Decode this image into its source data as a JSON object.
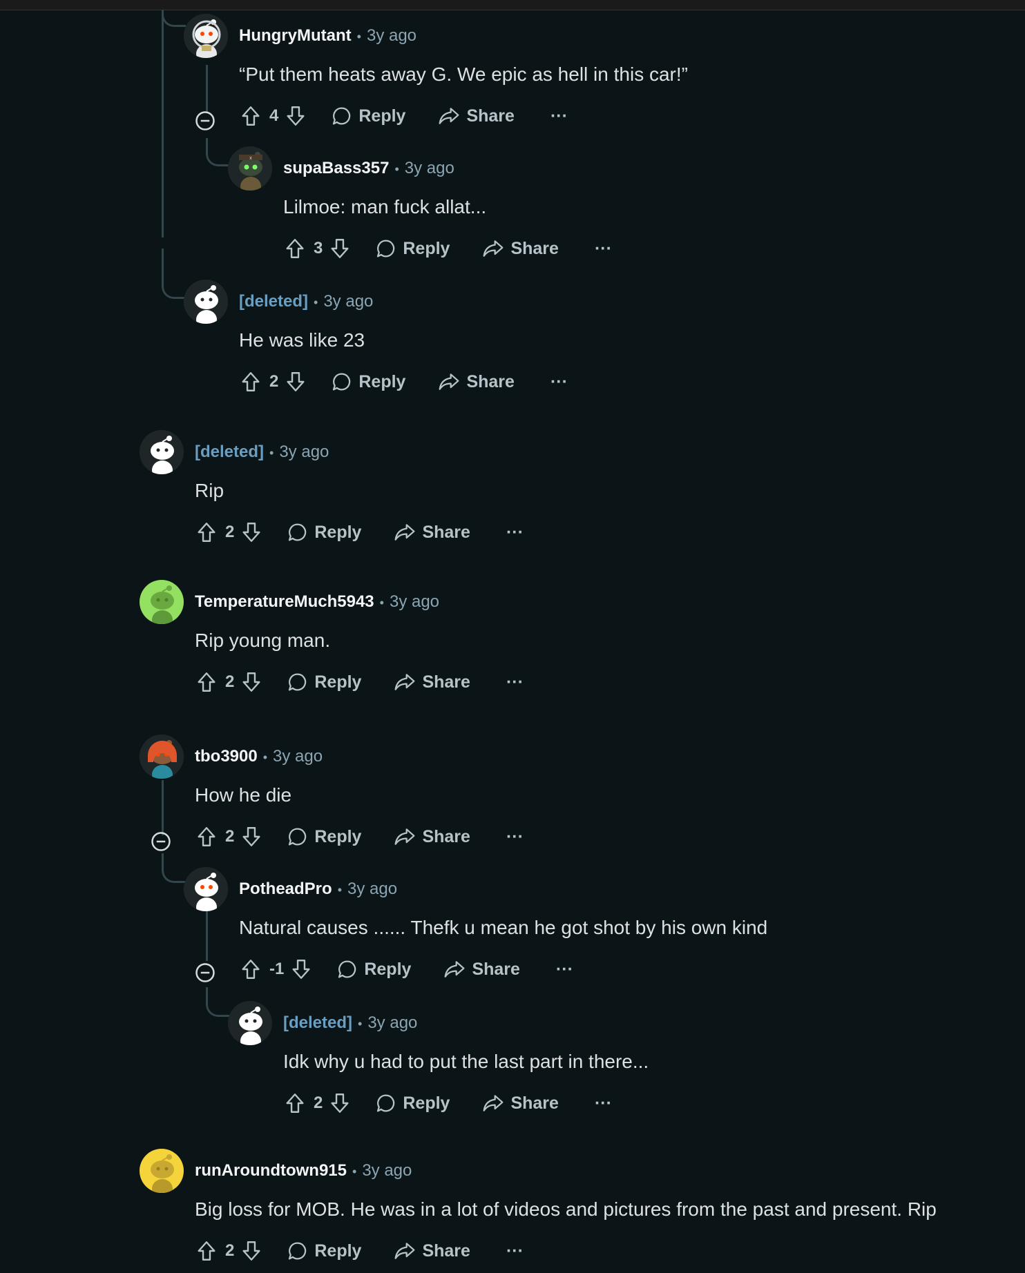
{
  "labels": {
    "reply": "Reply",
    "share": "Share",
    "more": "···"
  },
  "colors": {
    "background": "#0b1416",
    "deleted_author": "#6a9fc4",
    "meta_text": "#8aa5b3",
    "action_text": "#b6c3c9"
  },
  "comments": [
    {
      "author": "HungryMutant",
      "time": "3y ago",
      "body": "“Put them heats away G. We epic as hell in this car!”",
      "score": "4",
      "avatar_icon": "astronaut-snoo-avatar-icon"
    },
    {
      "author": "supaBass357",
      "time": "3y ago",
      "body": "Lilmoe: man fuck allat...",
      "score": "3",
      "avatar_icon": "pirate-snoo-avatar-icon"
    },
    {
      "author": "[deleted]",
      "time": "3y ago",
      "body": "He was like 23",
      "score": "2",
      "avatar_icon": "deleted-snoo-avatar-icon"
    },
    {
      "author": "[deleted]",
      "time": "3y ago",
      "body": "Rip",
      "score": "2",
      "avatar_icon": "deleted-snoo-avatar-icon"
    },
    {
      "author": "TemperatureMuch5943",
      "time": "3y ago",
      "body": "Rip young man.",
      "score": "2",
      "avatar_icon": "green-snoo-avatar-icon"
    },
    {
      "author": "tbo3900",
      "time": "3y ago",
      "body": "How he die",
      "score": "2",
      "avatar_icon": "hooded-snoo-avatar-icon"
    },
    {
      "author": "PotheadPro",
      "time": "3y ago",
      "body": "Natural causes ...... Thefk u mean he got shot by his own kind",
      "score": "-1",
      "avatar_icon": "default-snoo-avatar-icon"
    },
    {
      "author": "[deleted]",
      "time": "3y ago",
      "body": "Idk why u had to put the last part in there...",
      "score": "2",
      "avatar_icon": "deleted-snoo-avatar-icon"
    },
    {
      "author": "runAroundtown915",
      "time": "3y ago",
      "body": "Big loss for MOB. He was in a lot of videos and pictures from the past and present. Rip",
      "score": "2",
      "avatar_icon": "yellow-snoo-avatar-icon"
    }
  ]
}
